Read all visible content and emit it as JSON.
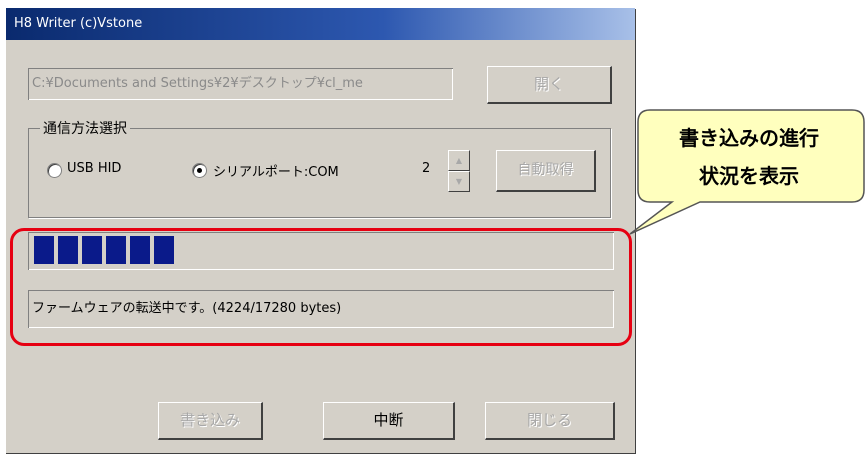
{
  "window": {
    "title": "H8 Writer (c)Vstone"
  },
  "file": {
    "path": "C:¥Documents and Settings¥2¥デスクトップ¥cl_me",
    "open_label": "開く"
  },
  "comm": {
    "group_label": "通信方法選択",
    "usb_label": "USB HID",
    "usb_selected": false,
    "serial_label": "シリアルポート:COM",
    "serial_selected": true,
    "port": "2",
    "auto_label": "自動取得"
  },
  "progress": {
    "bytes_done": 4224,
    "bytes_total": 17280,
    "fraction": 0.244
  },
  "status": {
    "text": "ファームウェアの転送中です。(4224/17280 bytes)"
  },
  "buttons": {
    "write": "書き込み",
    "abort": "中断",
    "close": "閉じる"
  },
  "annotation": {
    "line1": "書き込みの進行",
    "line2": "状況を表示"
  },
  "colors": {
    "highlight": "#e60012",
    "callout_fill": "#ffffbe",
    "progress": "#0a1a8a"
  },
  "icons": {
    "radio": "radio-button",
    "spin": "spin-button"
  }
}
